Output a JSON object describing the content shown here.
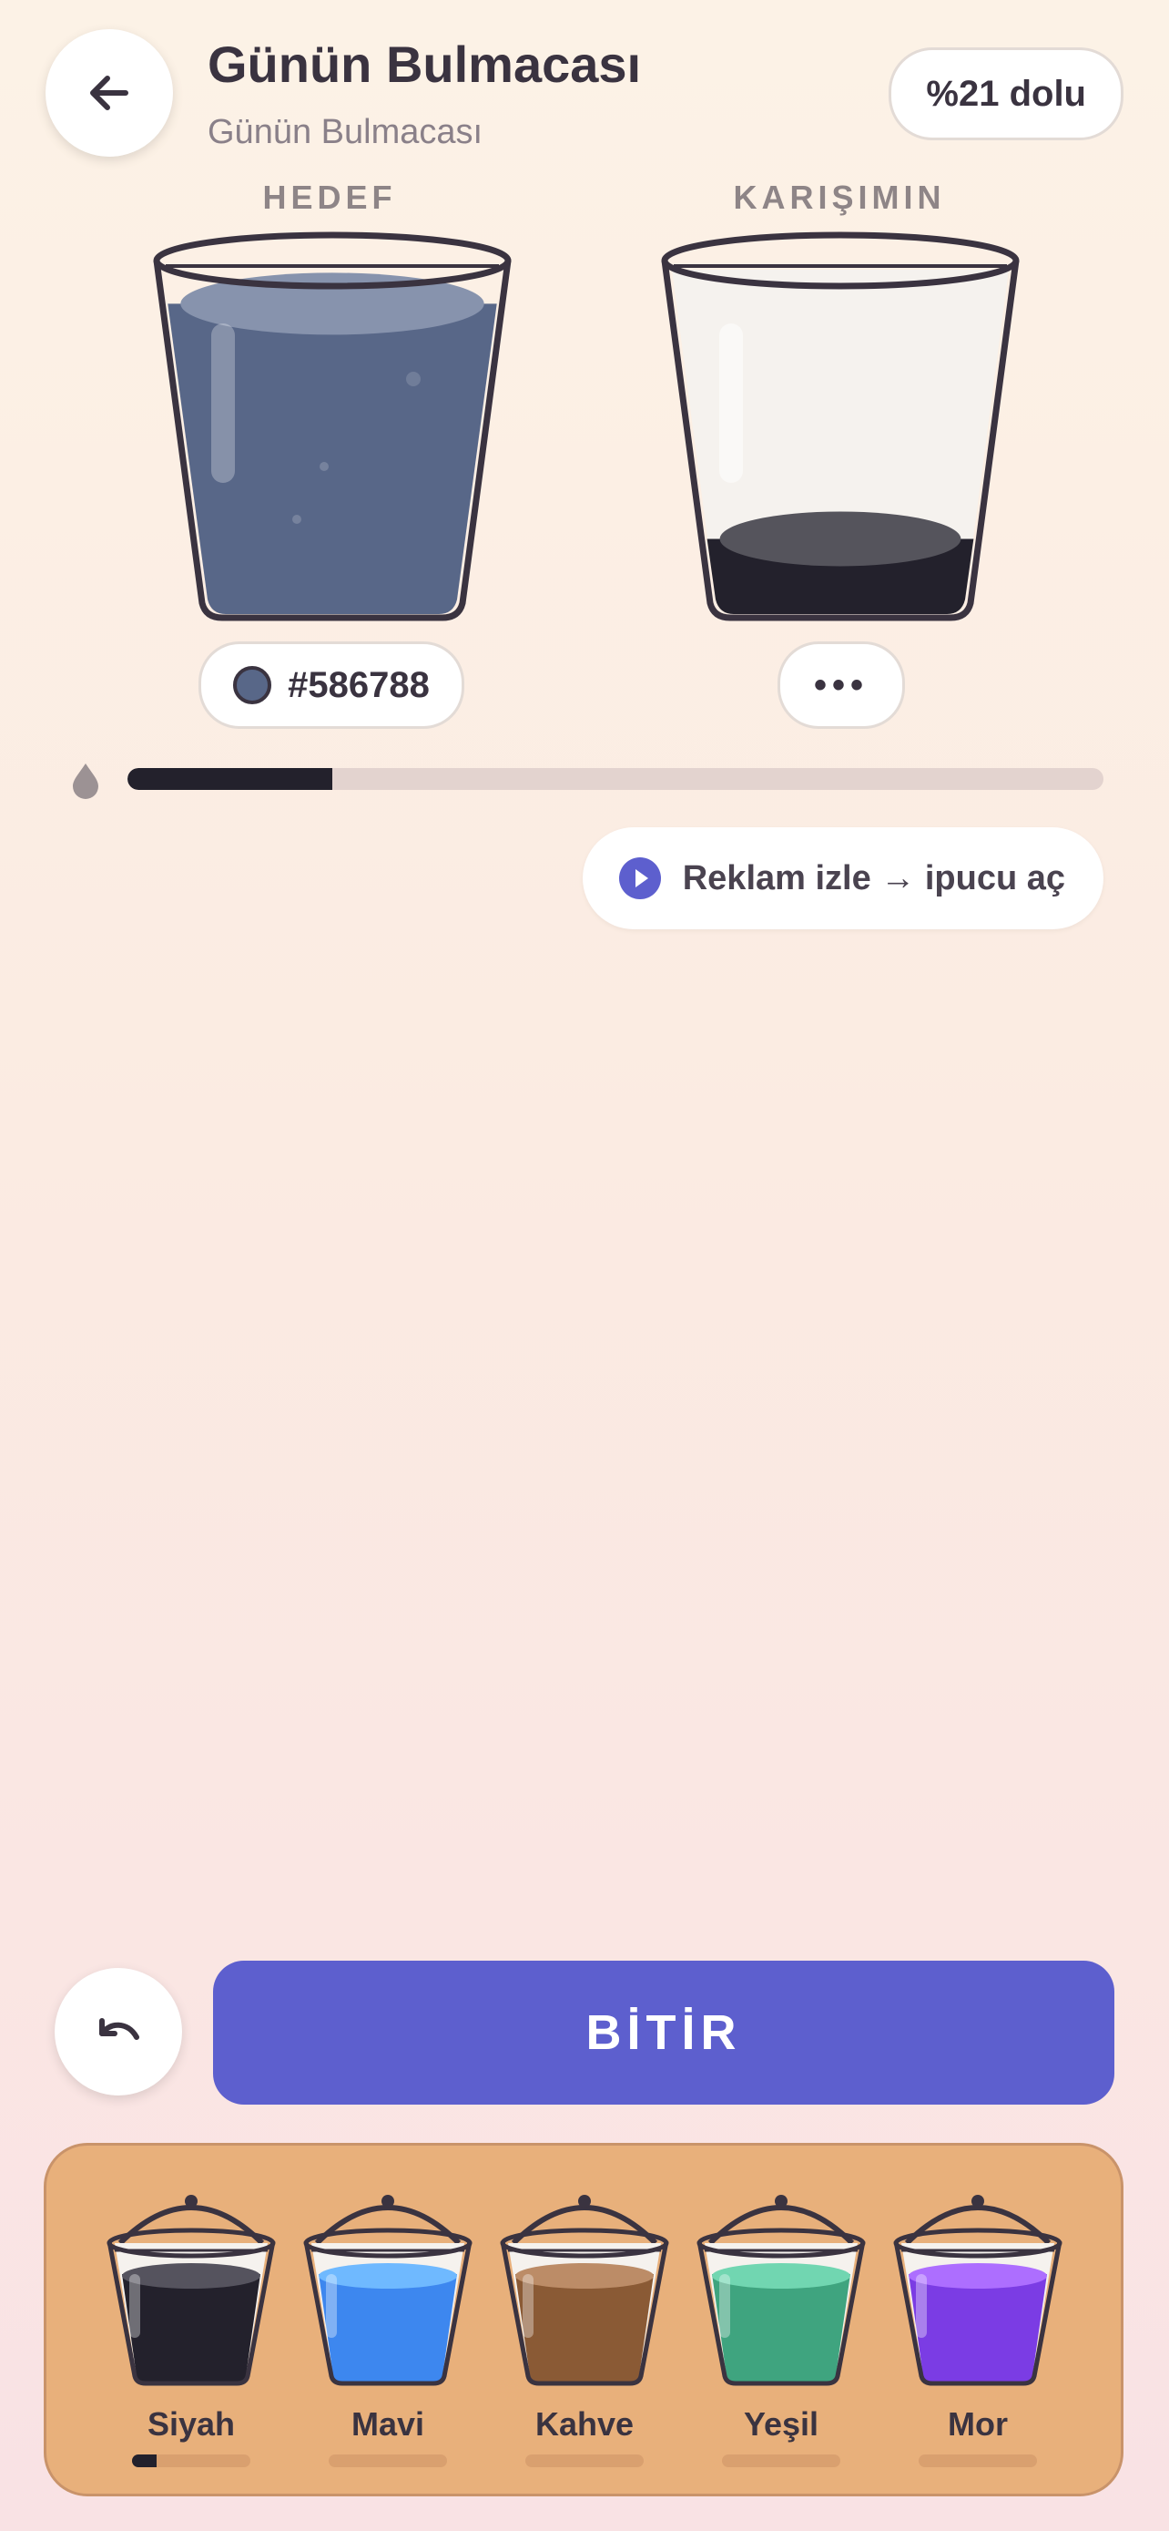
{
  "header": {
    "title": "Günün Bulmacası",
    "subtitle": "Günün Bulmacası",
    "fill_badge": "%21 dolu",
    "back_icon": "arrow-left-icon"
  },
  "target": {
    "label": "HEDEF",
    "color": "#586788",
    "hex_label": "#586788",
    "fill_level": 0.9
  },
  "mix": {
    "label": "KARIŞIMIN",
    "color": "#23212c",
    "chip_label": "•••",
    "fill_level": 0.21
  },
  "progress": {
    "icon": "drop-icon",
    "value": 0.21
  },
  "hint_button": {
    "label": "Reklam izle → ipucu aç",
    "icon": "play-icon"
  },
  "controls": {
    "undo_icon": "undo-icon",
    "finish_label": "BİTİR"
  },
  "palette": [
    {
      "name": "Siyah",
      "color": "#23212c",
      "used": 0.21
    },
    {
      "name": "Mavi",
      "color": "#3d87ef",
      "used": 0
    },
    {
      "name": "Kahve",
      "color": "#8a5a35",
      "used": 0
    },
    {
      "name": "Yeşil",
      "color": "#3fa47f",
      "used": 0
    },
    {
      "name": "Mor",
      "color": "#7b3ce4",
      "used": 0
    }
  ]
}
